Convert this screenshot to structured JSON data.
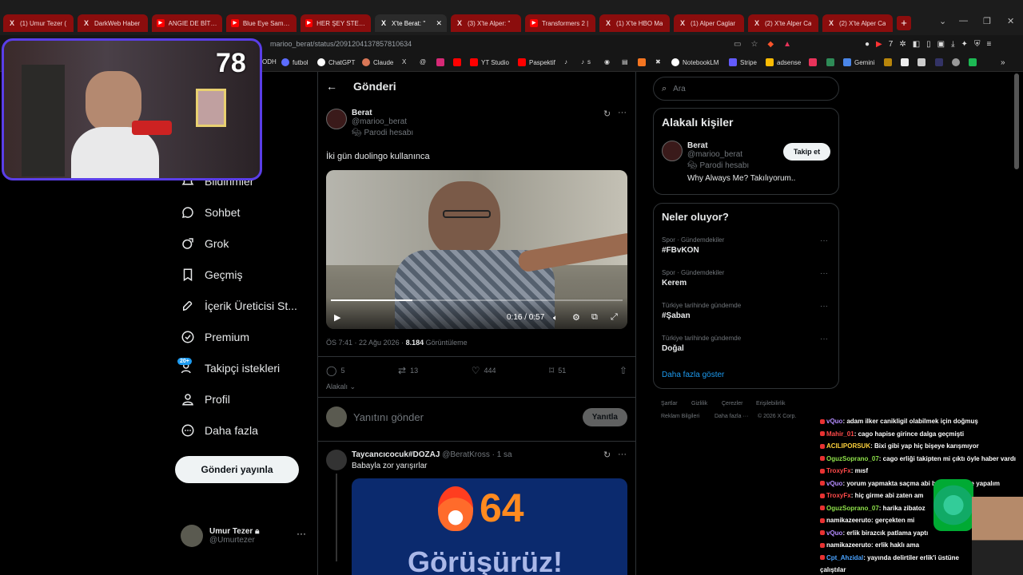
{
  "tabs": [
    {
      "label": "(1) Umur Tezer (",
      "icon": "x-logo-icon"
    },
    {
      "label": "DarkWeb Haber",
      "icon": "x-logo-icon"
    },
    {
      "label": "ANGIE DE BİTTİ !",
      "icon": "youtube-icon"
    },
    {
      "label": "Blue Eye Samura",
      "icon": "youtube-icon"
    },
    {
      "label": "HER ŞEY STEVE !",
      "icon": "youtube-icon"
    },
    {
      "label": "X'te Berat: \"",
      "icon": "x-logo-icon",
      "active": true
    },
    {
      "label": "(3) X'te Alper: \"",
      "icon": "x-logo-icon"
    },
    {
      "label": "Transformers 2 |",
      "icon": "youtube-icon"
    },
    {
      "label": "(1) X'te HBO Ma",
      "icon": "x-logo-icon"
    },
    {
      "label": "(1) Alper Caglar",
      "icon": "x-logo-icon"
    },
    {
      "label": "(2) X'te Alper Ca",
      "icon": "x-logo-icon"
    },
    {
      "label": "(2) X'te Alper Ca",
      "icon": "x-logo-icon"
    }
  ],
  "address": {
    "url": "marioo_berat/status/2091204137857810634"
  },
  "bookmarks": [
    "ODH",
    "futbol",
    "ChatGPT",
    "Claude",
    "YT Studio",
    "Paspektif",
    "s",
    "NotebookLM",
    "Stripe",
    "adsense",
    "Gemini"
  ],
  "stream": {
    "viewer_count": "78"
  },
  "nav": [
    {
      "label": "Bildirimler",
      "icon": "bell-icon"
    },
    {
      "label": "Sohbet",
      "icon": "chat-bubble-icon"
    },
    {
      "label": "Grok",
      "icon": "grok-icon"
    },
    {
      "label": "Geçmiş",
      "icon": "bookmark-icon"
    },
    {
      "label": "İçerik Üreticisi St...",
      "icon": "rocket-icon"
    },
    {
      "label": "Premium",
      "icon": "verified-icon"
    },
    {
      "label": "Takipçi istekleri",
      "icon": "follow-requests-icon",
      "badge": "20+"
    },
    {
      "label": "Profil",
      "icon": "profile-icon"
    },
    {
      "label": "Daha fazla",
      "icon": "more-circle-icon"
    }
  ],
  "publish_button": "Gönderi yayınla",
  "current_user": {
    "name": "Umur Tezer",
    "handle": "@Umurtezer"
  },
  "header": {
    "title": "Gönderi"
  },
  "tweet": {
    "author": "Berat",
    "handle": "@marioo_berat",
    "parody": "Parodi hesabı",
    "text": "İki gün duolingo kullanınca",
    "video_time": "0:16 / 0:57",
    "video_progress": 0.28,
    "timestamp": "ÖS 7:41 · 22 Ağu 2026 · ",
    "views_count": "8.184",
    "views_label": " Görüntüleme",
    "replies": "5",
    "retweets": "13",
    "likes": "444",
    "bookmarks": "51",
    "sort_label": "Alakalı"
  },
  "reply_box": {
    "placeholder": "Yanıtını gönder",
    "button": "Yanıtla"
  },
  "reply": {
    "author": "Taycancıcocuk#DOZAJ",
    "handle": "@BeratKross · 1 sa",
    "text": "Babayla zor yarışırlar",
    "image_number": "64",
    "image_text": "Görüşürüz!"
  },
  "search": {
    "placeholder": "Ara"
  },
  "related": {
    "title": "Alakalı kişiler",
    "name": "Berat",
    "handle": "@marioo_berat",
    "parody": "Parodi hesabı",
    "bio": "Why Always Me? Takılıyorum..",
    "follow": "Takip et"
  },
  "trends": {
    "title": "Neler oluyor?",
    "items": [
      {
        "context": "Spor · Gündemdekiler",
        "name": "#FBvKON"
      },
      {
        "context": "Spor · Gündemdekiler",
        "name": "Kerem"
      },
      {
        "context": "Türkiye tarihinde gündemde",
        "name": "#Şaban"
      },
      {
        "context": "Türkiye tarihinde gündemde",
        "name": "Doğal"
      }
    ],
    "more": "Daha fazla göster"
  },
  "footer": [
    "Şartlar",
    "Gizlilik",
    "Çerezler",
    "Erişilebilirlik",
    "Reklam Bilgileri",
    "Daha fazla ···",
    "© 2026 X Corp."
  ],
  "chat": [
    {
      "user": "vQuo",
      "color": "#b48cff",
      "msg": ": adam ilker canikligil olabilmek için doğmuş"
    },
    {
      "user": "Mahir_01",
      "color": "#ff4a4a",
      "msg": ": cago hapise girince dalga geçmişti"
    },
    {
      "user": "ACILIPORSUK",
      "color": "#ffd23c",
      "msg": ": Bixi gibi yap hiç bişeye karışmıyor"
    },
    {
      "user": "OguzSoprano_07",
      "color": "#8fe04a",
      "msg": ": cago erliği takipten mi çıktı öyle haber vardı"
    },
    {
      "user": "TroxyFx",
      "color": "#ff4a4a",
      "msg": ": mısf"
    },
    {
      "user": "vQuo",
      "color": "#b48cff",
      "msg": ": yorum yapmakta saçma abi bence yani ne yapalım"
    },
    {
      "user": "TroxyFx",
      "color": "#ff4a4a",
      "msg": ": hiç girme abi zaten am"
    },
    {
      "user": "OguzSoprano_07",
      "color": "#8fe04a",
      "msg": ": harika zibatoz"
    },
    {
      "user": "namikazeeruto",
      "color": "#ffffff",
      "msg": ": gerçekten mi"
    },
    {
      "user": "vQuo",
      "color": "#b48cff",
      "msg": ": erlik birazcık patlama yaptı"
    },
    {
      "user": "namikazeeruto",
      "color": "#ffffff",
      "msg": ": erlik haklı ama"
    },
    {
      "user": "Cpt_Ahzidal",
      "color": "#4aa3ff",
      "msg": ": yayında delirtiler erlik'i üstüne"
    },
    {
      "user": "",
      "color": "#ffffff",
      "msg": "çalıştılar"
    }
  ]
}
